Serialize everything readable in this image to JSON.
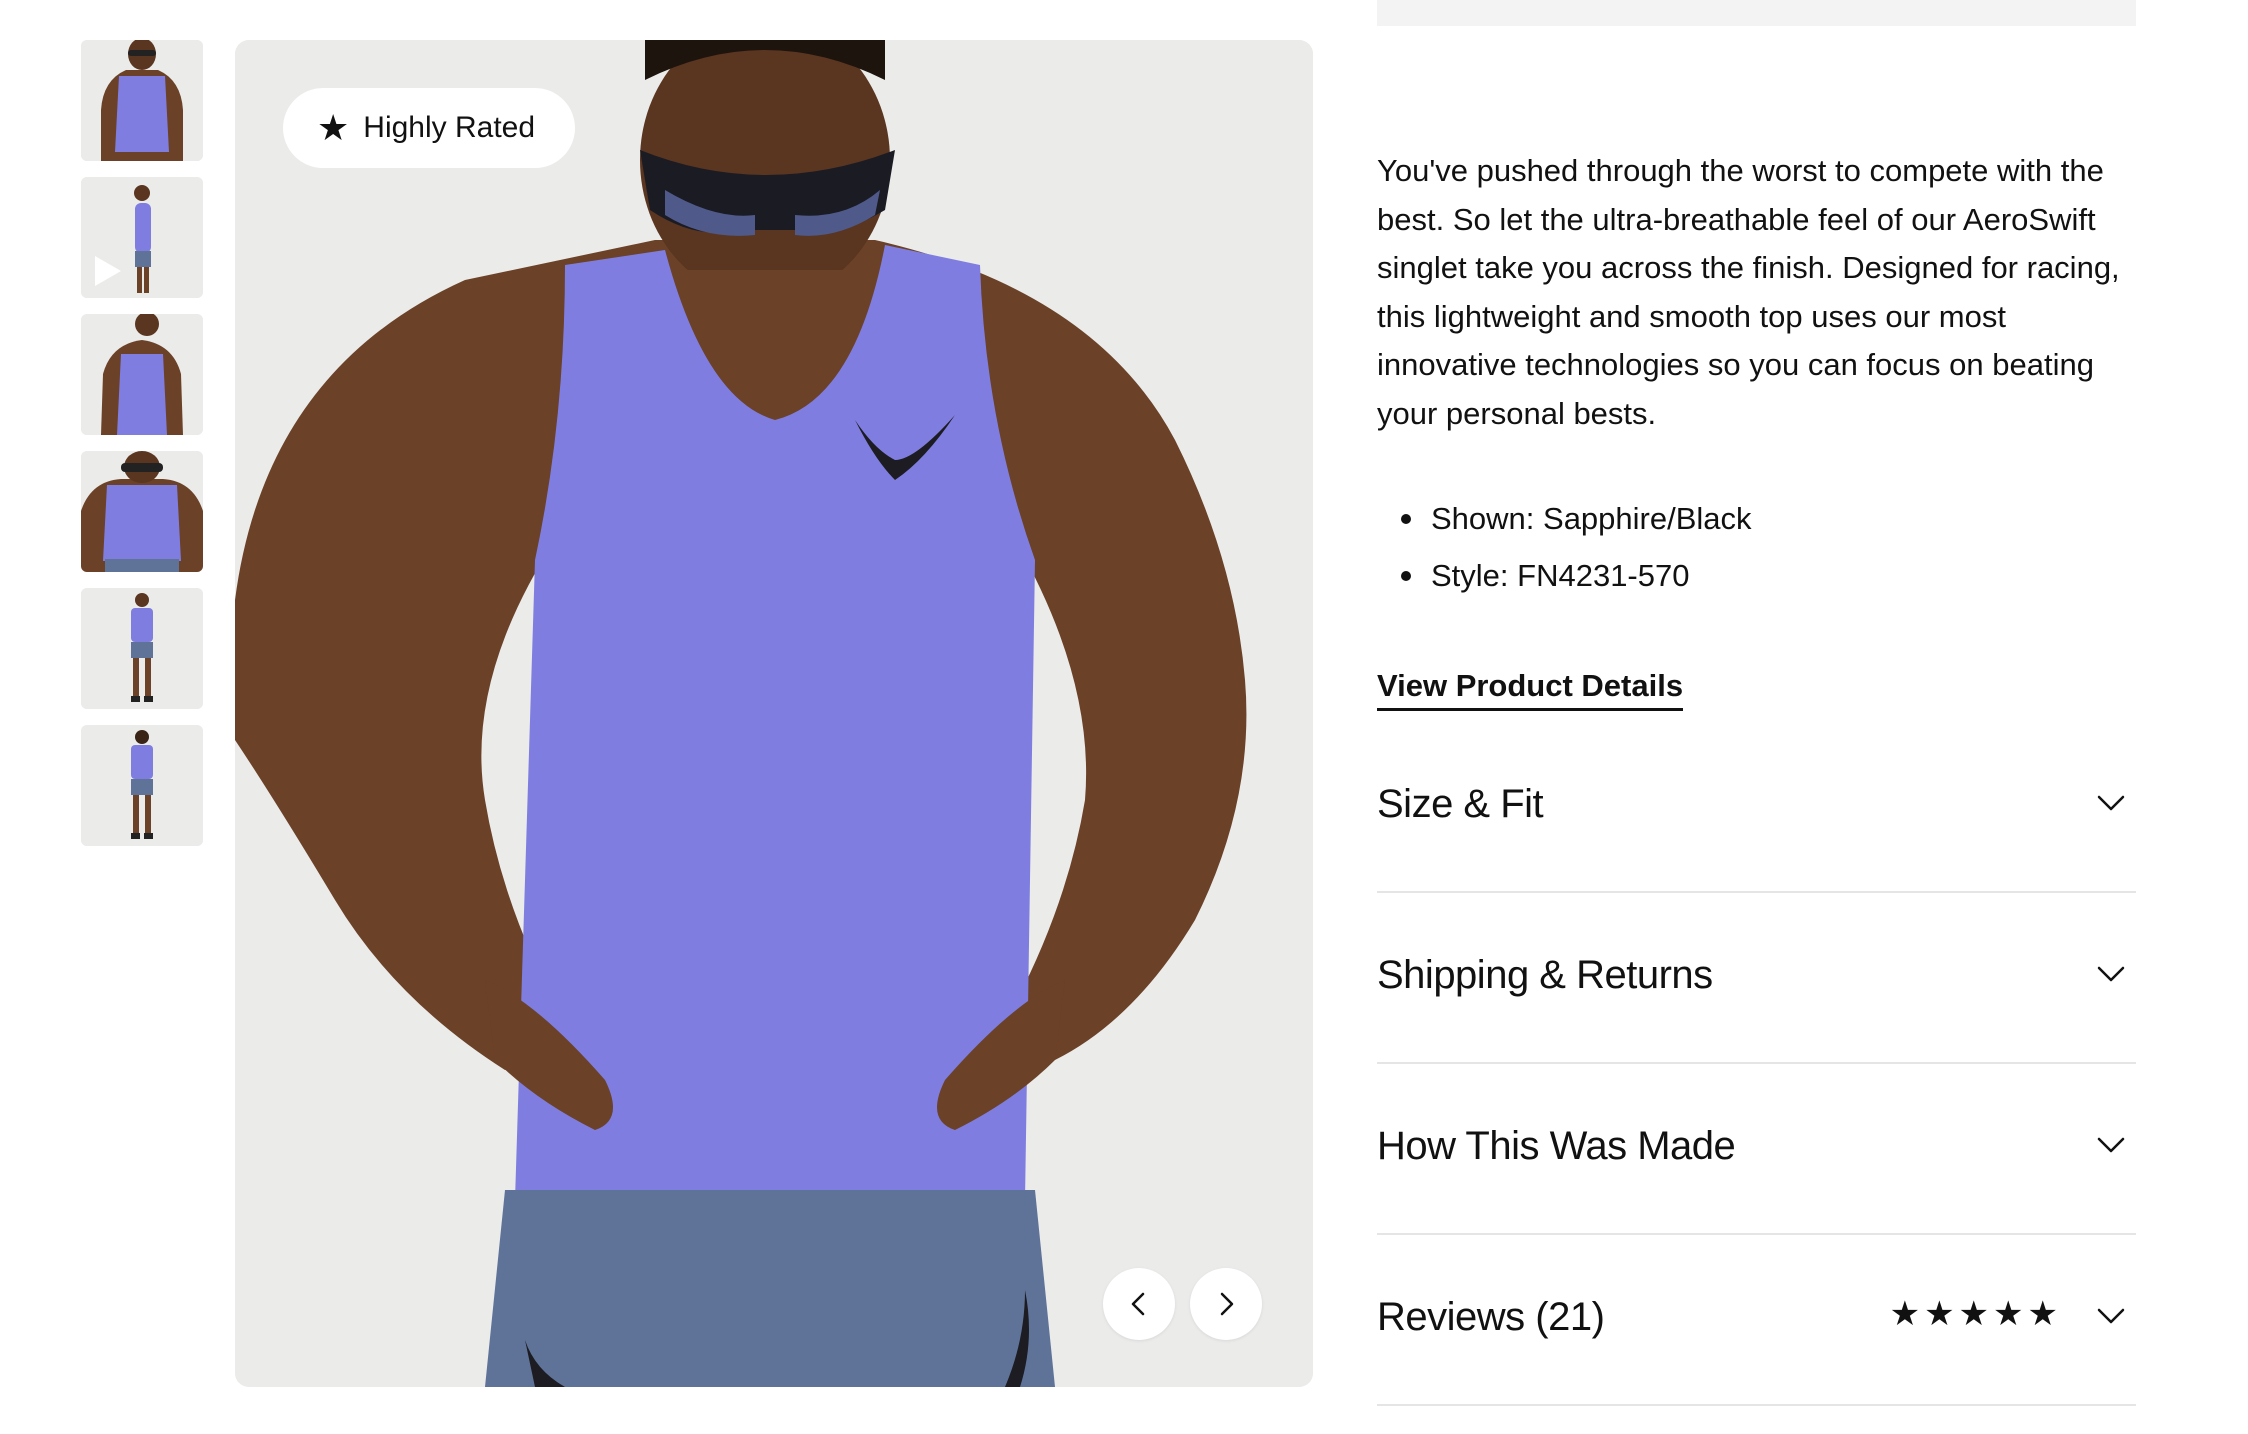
{
  "gallery": {
    "thumbnails": [
      {
        "label": "front-view",
        "has_play": false
      },
      {
        "label": "side-view-video",
        "has_play": true
      },
      {
        "label": "back-view",
        "has_play": false
      },
      {
        "label": "detail-view",
        "has_play": false
      },
      {
        "label": "full-body-front",
        "has_play": false
      },
      {
        "label": "full-body-back",
        "has_play": false
      }
    ],
    "badge_text": "Highly Rated",
    "badge_icon": "star-icon",
    "prev_icon": "chevron-left-icon",
    "next_icon": "chevron-right-icon",
    "colors": {
      "background": "#ebebea",
      "singlet": "#7f7ee0",
      "skin": "#6b4128",
      "shorts": "#5f7399"
    }
  },
  "product": {
    "description": "You've pushed through the worst to compete with the best. So let the ultra-breathable feel of our AeroSwift singlet take you across the finish. Designed for racing, this lightweight and smooth top uses our most innovative technologies so you can focus on beating your personal bests.",
    "bullets": [
      "Shown: Sapphire/Black",
      "Style: FN4231-570"
    ],
    "details_link": "View Product Details"
  },
  "accordions": [
    {
      "title": "Size & Fit",
      "icon": "chevron-down-icon"
    },
    {
      "title": "Shipping & Returns",
      "icon": "chevron-down-icon"
    },
    {
      "title": "How This Was Made",
      "icon": "chevron-down-icon"
    },
    {
      "title": "Reviews (21)",
      "icon": "chevron-down-icon",
      "rating": 4.6,
      "rating_max": 5
    }
  ]
}
